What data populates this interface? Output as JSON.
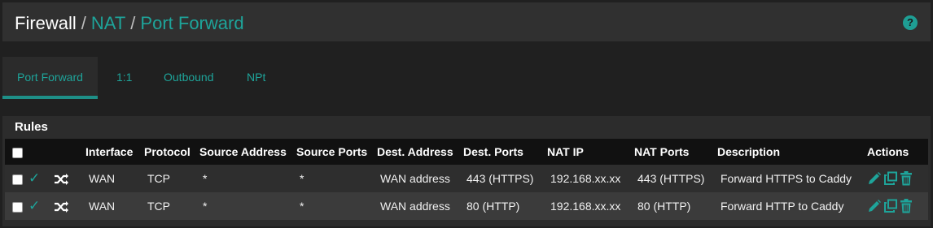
{
  "breadcrumb": {
    "root": "Firewall",
    "items": [
      "NAT",
      "Port Forward"
    ]
  },
  "help_icon": "question-circle-icon",
  "tabs": [
    {
      "label": "Port Forward",
      "active": true
    },
    {
      "label": "1:1",
      "active": false
    },
    {
      "label": "Outbound",
      "active": false
    },
    {
      "label": "NPt",
      "active": false
    }
  ],
  "rules": {
    "title": "Rules",
    "columns": [
      "Interface",
      "Protocol",
      "Source Address",
      "Source Ports",
      "Dest. Address",
      "Dest. Ports",
      "NAT IP",
      "NAT Ports",
      "Description",
      "Actions"
    ],
    "rows": [
      {
        "interface": "WAN",
        "protocol": "TCP",
        "source_address": "*",
        "source_ports": "*",
        "dest_address": "WAN address",
        "dest_ports": "443 (HTTPS)",
        "nat_ip": "192.168.xx.xx",
        "nat_ports": "443 (HTTPS)",
        "description": "Forward HTTPS to Caddy"
      },
      {
        "interface": "WAN",
        "protocol": "TCP",
        "source_address": "*",
        "source_ports": "*",
        "dest_address": "WAN address",
        "dest_ports": "80 (HTTP)",
        "nat_ip": "192.168.xx.xx",
        "nat_ports": "80 (HTTP)",
        "description": "Forward HTTP to Caddy"
      }
    ]
  },
  "icons": {
    "enabled": "check-icon",
    "nat": "shuffle-icon",
    "edit": "pencil-icon",
    "copy": "clone-icon",
    "delete": "trash-icon"
  },
  "colors": {
    "accent": "#1ea49a",
    "header_bg": "#303030",
    "page_bg": "#202020",
    "table_head_bg": "#111111"
  }
}
